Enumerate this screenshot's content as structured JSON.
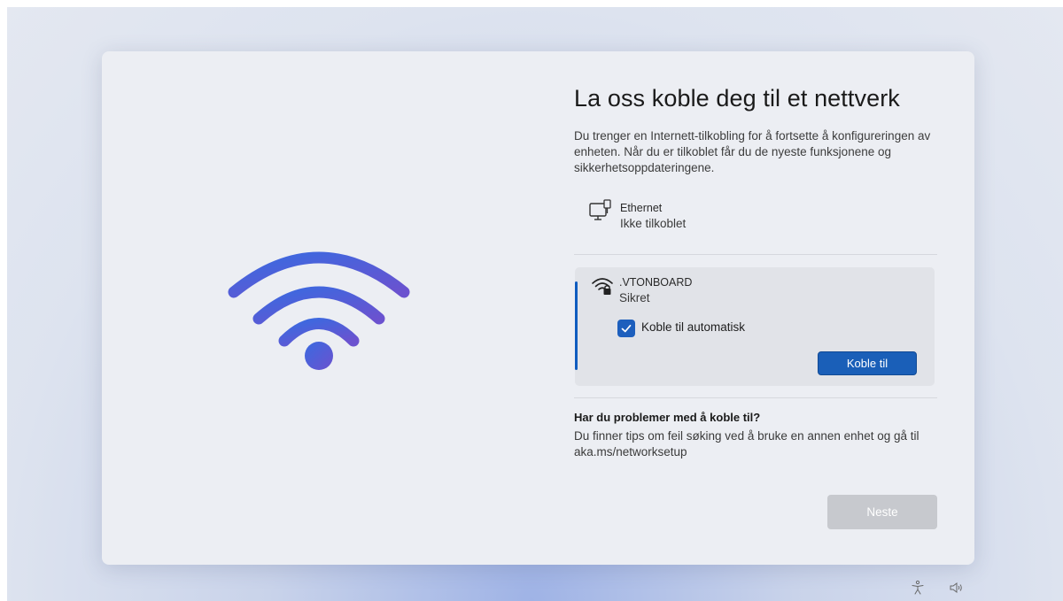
{
  "page": {
    "title": "La oss koble deg til et nettverk",
    "description": "Du trenger en Internett-tilkobling for å fortsette å konfigureringen av enheten. Når du er tilkoblet får du de nyeste funksjonene og sikkerhetsoppdateringene."
  },
  "ethernet": {
    "name": "Ethernet",
    "status": "Ikke tilkoblet",
    "icon": "ethernet-icon"
  },
  "wifi_network": {
    "ssid": ".VTONBOARD",
    "security": "Sikret",
    "auto_connect_label": "Koble til automatisk",
    "auto_connect_checked": true,
    "connect_label": "Koble til",
    "icon": "wifi-secure-icon"
  },
  "help": {
    "title": "Har du problemer med å koble til?",
    "text": "Du finner tips om feil søking ved å bruke en annen enhet og gå til aka.ms/networksetup"
  },
  "footer": {
    "next_label": "Neste"
  },
  "tray": {
    "icons": [
      "accessibility-icon",
      "volume-icon"
    ]
  },
  "colors": {
    "accent": "#1a5fb8",
    "wifi_gradient_start": "#3f63dd",
    "wifi_gradient_end": "#6a55cf",
    "disabled_button": "#c7c9ce"
  }
}
